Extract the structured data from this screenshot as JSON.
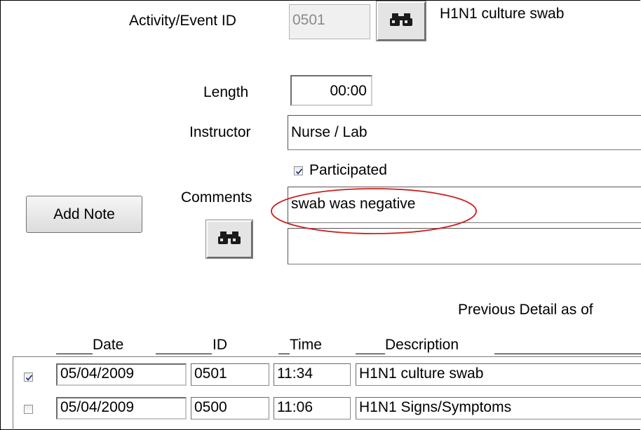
{
  "activity": {
    "label": "Activity/Event ID",
    "id_value": "0501",
    "description": "H1N1 culture swab"
  },
  "length": {
    "label": "Length",
    "value": "00:00"
  },
  "instructor": {
    "label": "Instructor",
    "value": "Nurse / Lab"
  },
  "participated": {
    "label": "Participated",
    "checked": true
  },
  "comments": {
    "label": "Comments",
    "line1": "swab was negative",
    "line2": ""
  },
  "add_note_label": "Add Note",
  "previous_detail": "Previous Detail as of",
  "table": {
    "headers": [
      "Date",
      "ID",
      "Time",
      "Description"
    ],
    "rows": [
      {
        "checked": true,
        "date": "05/04/2009",
        "id": "0501",
        "time": "11:34",
        "description": "H1N1 culture swab"
      },
      {
        "checked": false,
        "date": "05/04/2009",
        "id": "0500",
        "time": "11:06",
        "description": "H1N1 Signs/Symptoms"
      }
    ]
  },
  "annotation_color": "#cc1f1f",
  "icons": {
    "lookup": "binoculars-icon"
  }
}
